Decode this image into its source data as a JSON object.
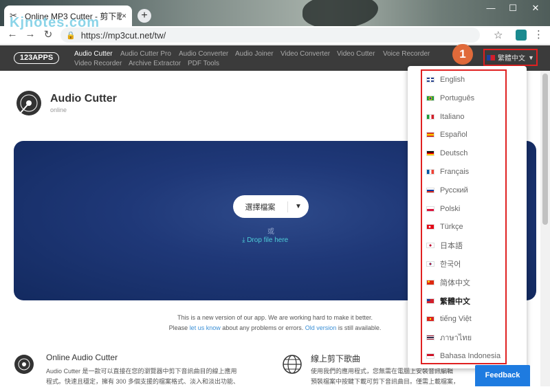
{
  "browser": {
    "tab_title": "Online MP3 Cutter - 剪下歌曲",
    "tab_close": "×",
    "new_tab": "+",
    "url": "https://mp3cut.net/tw/",
    "watermark": "Kjnotes.com",
    "minimize": "—",
    "maximize": "☐",
    "close": "✕"
  },
  "appnav": {
    "logo": "123APPS",
    "links": [
      "Audio Cutter",
      "Audio Cutter Pro",
      "Audio Converter",
      "Audio Joiner",
      "Video Converter",
      "Video Cutter",
      "Voice Recorder",
      "Video Recorder",
      "Archive Extractor",
      "PDF Tools"
    ],
    "lang_label": "繁體中文"
  },
  "annotation": {
    "badge": "1"
  },
  "header": {
    "title": "Audio Cutter",
    "subtitle": "online"
  },
  "hero": {
    "choose_file": "選擇檔案",
    "or": "或",
    "drop_file": "Drop file here"
  },
  "note": {
    "line1": "This is a new version of our app. We are working hard to make it better.",
    "line2_pre": "Please ",
    "let_us_know": "let us know",
    "line2_mid": " about any problems or errors. ",
    "old_version": "Old version",
    "line2_post": " is still available."
  },
  "sections": {
    "left_title": "Online Audio Cutter",
    "left_text1": "Audio Cutter 是一款可以直接在您的瀏覽器中剪下音訊曲目的線上應用",
    "left_text2": "程式。快速且穩定，擁有 300 多個支援的檔案格式、淡入和淡出功能、",
    "right_title": "線上剪下歌曲",
    "right_text1": "使用我們的應用程式，您無需在電腦上安裝音訊編輯",
    "right_text2": "預裝檔案中按鍵下載可剪下音訊曲目。僅需上載檔案，"
  },
  "languages": [
    {
      "label": "English",
      "flag": "uk"
    },
    {
      "label": "Português",
      "flag": "br"
    },
    {
      "label": "Italiano",
      "flag": "it"
    },
    {
      "label": "Español",
      "flag": "es"
    },
    {
      "label": "Deutsch",
      "flag": "de"
    },
    {
      "label": "Français",
      "flag": "fr"
    },
    {
      "label": "Русский",
      "flag": "ru"
    },
    {
      "label": "Polski",
      "flag": "pl"
    },
    {
      "label": "Türkçe",
      "flag": "tr"
    },
    {
      "label": "日本語",
      "flag": "jp"
    },
    {
      "label": "한국어",
      "flag": "kr"
    },
    {
      "label": "简体中文",
      "flag": "cn"
    },
    {
      "label": "繁體中文",
      "flag": "tw"
    },
    {
      "label": "tiếng Việt",
      "flag": "vn"
    },
    {
      "label": "ภาษาไทย",
      "flag": "th"
    },
    {
      "label": "Bahasa Indonesia",
      "flag": "id"
    }
  ],
  "selected_language": "繁體中文",
  "feedback": "Feedback",
  "colors": {
    "accent_red": "#e02020",
    "badge_orange": "#e06a3a",
    "feedback_blue": "#1e7be0",
    "nav_bg": "#3b3b3b"
  }
}
